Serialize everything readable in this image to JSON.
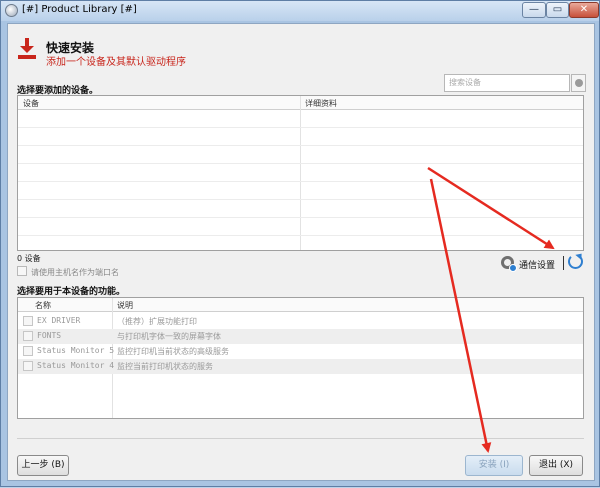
{
  "window": {
    "title": "[#] Product Library [#]",
    "min": "—",
    "max": "▭",
    "close": "✕"
  },
  "header": {
    "title": "快速安装",
    "subtitle": "添加一个设备及其默认驱动程序"
  },
  "devices": {
    "section_label": "选择要添加的设备。",
    "search_placeholder": "搜索设备",
    "columns": [
      "设备",
      "详细资料"
    ],
    "count_label": "0 设备",
    "use_hostname_label": "请使用主机名作为端口名",
    "comm_settings_label": "通信设置"
  },
  "functions": {
    "section_label": "选择要用于本设备的功能。",
    "columns": [
      "名称",
      "说明"
    ],
    "rows": [
      {
        "name": "EX DRIVER",
        "desc": "（推荐）扩展功能打印"
      },
      {
        "name": "FONTS",
        "desc": "与打印机字体一致的屏幕字体"
      },
      {
        "name": "Status Monitor 5",
        "desc": "监控打印机当前状态的高级服务"
      },
      {
        "name": "Status Monitor 4",
        "desc": "监控当前打印机状态的服务"
      }
    ]
  },
  "buttons": {
    "back": "上一步 (B)",
    "install": "安装 (I)",
    "exit": "退出 (X)"
  },
  "colors": {
    "accent_red": "#c8251b",
    "arrow_red": "#e52a20",
    "link_blue": "#2f7fd0"
  }
}
